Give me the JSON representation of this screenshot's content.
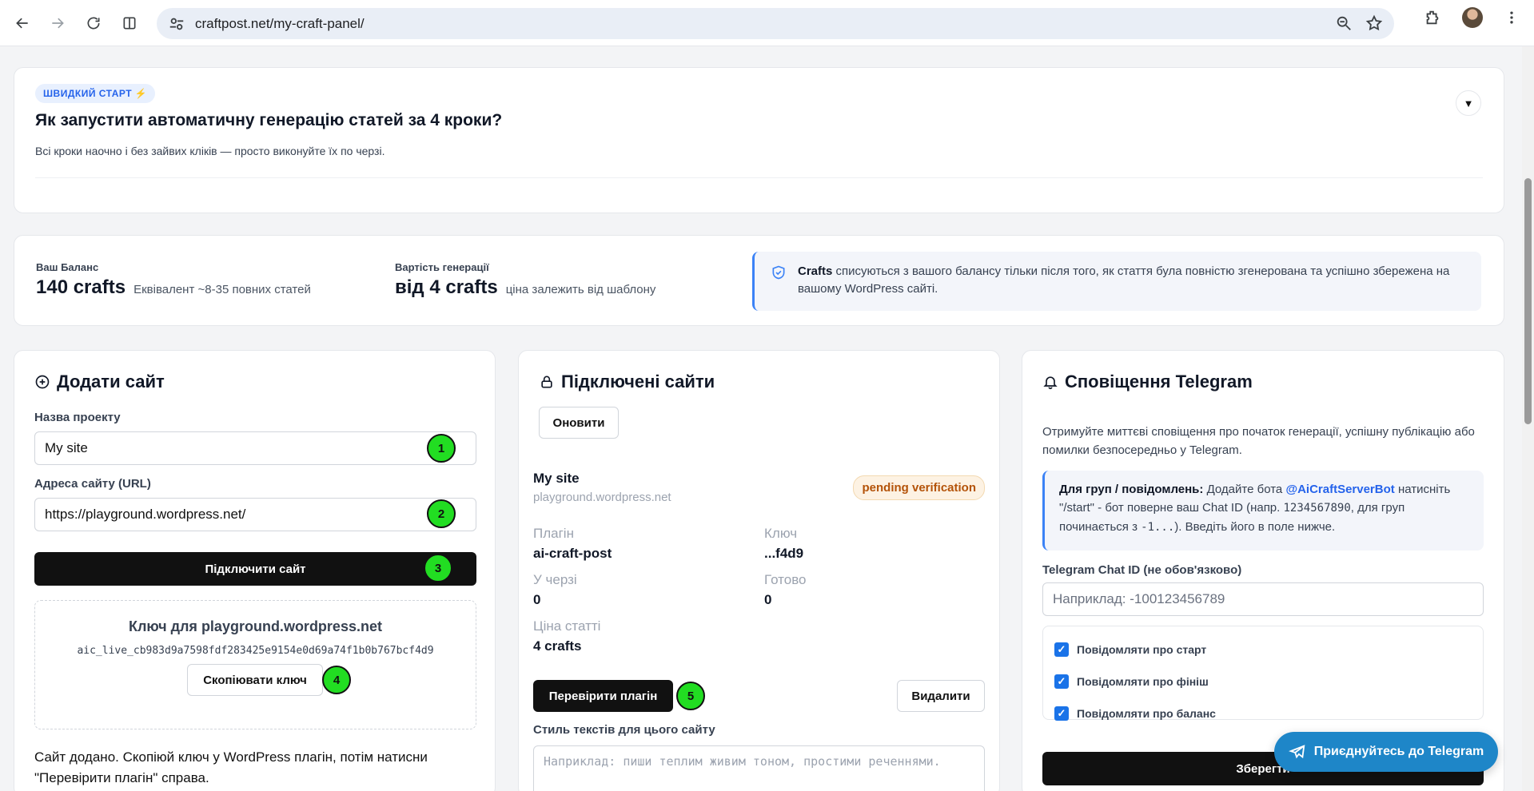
{
  "browser": {
    "url": "craftpost.net/my-craft-panel/"
  },
  "quickstart": {
    "badge": "ШВИДКИЙ СТАРТ ⚡",
    "title": "Як запустити автоматичну генерацію статей за 4 кроки?",
    "subtitle": "Всі кроки наочно і без зайвих кліків — просто виконуйте їх по черзі.",
    "toggle": "▼"
  },
  "balance": {
    "label": "Ваш Баланс",
    "value": "140 crafts",
    "sub": "Еквівалент ~8-35 повних статей",
    "cost_label": "Вартість генерації",
    "cost_value": "від 4 crafts",
    "cost_sub": "ціна залежить від шаблону",
    "note_bold": "Crafts",
    "note_text": "списуються з вашого балансу тільки після того, як стаття була повністю згенерована та успішно збережена на вашому WordPress сайті."
  },
  "add_site": {
    "title": "Додати сайт",
    "name_label": "Назва проекту",
    "name_value": "My site",
    "url_label": "Адреса сайту (URL)",
    "url_value": "https://playground.wordpress.net/",
    "connect_button": "Підключити сайт",
    "key_title": "Ключ для playground.wordpress.net",
    "key_value": "aic_live_cb983d9a7598fdf283425e9154e0d69a74f1b0b767bcf4d9",
    "copy_button": "Скопіювати ключ",
    "message": "Сайт додано. Скопіюй ключ у WordPress плагін, потім натисни \"Перевірити плагін\" справа.",
    "markers": [
      "1",
      "2",
      "3",
      "4"
    ]
  },
  "connected": {
    "title": "Підключені сайти",
    "refresh_button": "Оновити",
    "site_name": "My site",
    "site_domain": "playground.wordpress.net",
    "status": "pending verification",
    "plugin_label": "Плагін",
    "plugin_value": "ai-craft-post",
    "key_label": "Ключ",
    "key_value": "...f4d9",
    "queue_label": "У черзі",
    "queue_value": "0",
    "done_label": "Готово",
    "done_value": "0",
    "price_label": "Ціна статті",
    "price_value": "4 crafts",
    "verify_button": "Перевірити плагін",
    "delete_button": "Видалити",
    "style_label": "Стиль текстів для цього сайту",
    "style_placeholder": "Наприклад: пиши теплим живим тоном, простими реченнями.",
    "marker": "5"
  },
  "telegram": {
    "title": "Сповіщення Telegram",
    "desc": "Отримуйте миттєві сповіщення про початок генерації, успішну публікацію або помилки безпосередньо у Telegram.",
    "note_bold": "Для груп / повідомлень:",
    "note_text1": "Додайте бота",
    "note_link": "@AiCraftServerBot",
    "note_text2": "натисніть \"/start\" - бот поверне ваш Chat ID (напр.",
    "note_code1": "1234567890",
    "note_text3": ", для груп починається з",
    "note_code2": "-1...",
    "note_text4": "). Введіть його в поле нижче.",
    "chat_label": "Telegram Chat ID (не обов'язково)",
    "chat_placeholder": "Наприклад: -100123456789",
    "check_start": "Повідомляти про старт",
    "check_finish": "Повідомляти про фініш",
    "check_balance": "Повідомляти про баланс",
    "save_button": "Зберегти",
    "join_button": "Приєднуйтесь до Telegram"
  }
}
